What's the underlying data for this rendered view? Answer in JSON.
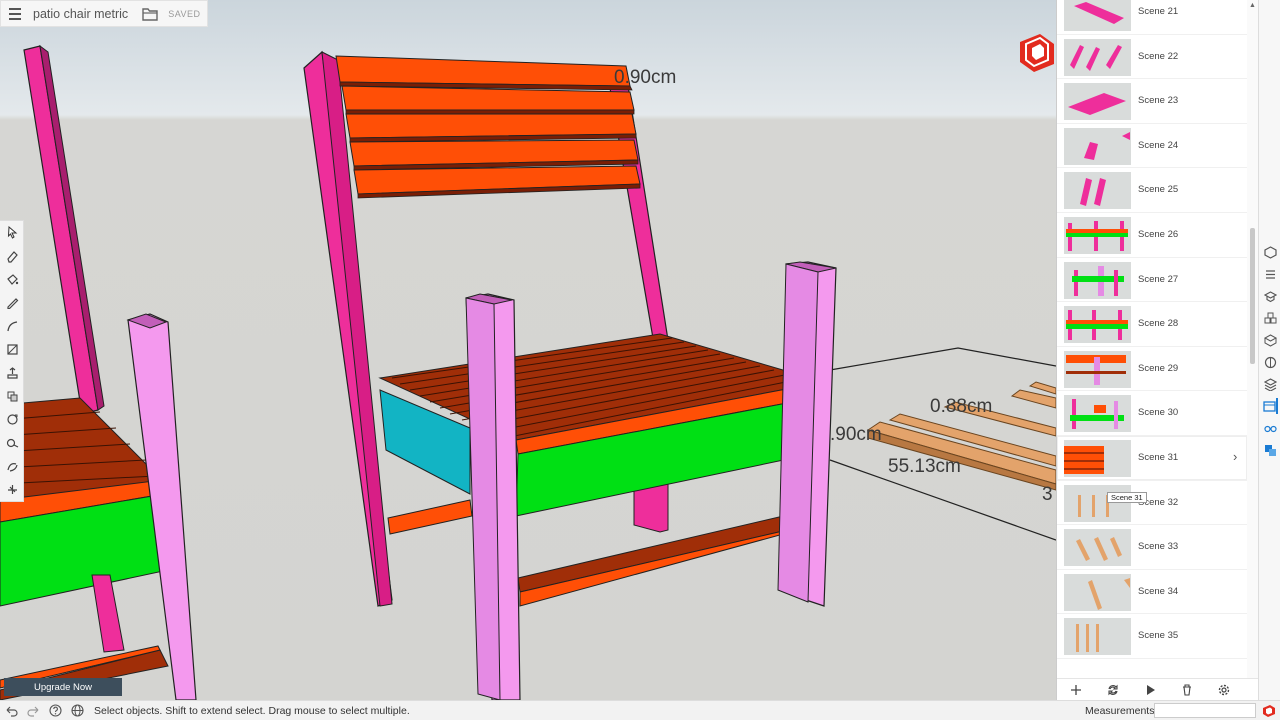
{
  "app": {
    "document_title": "patio chair metric",
    "save_state": "SAVED"
  },
  "viewport": {
    "dimensions": [
      "0.90cm",
      "0.88cm",
      ".90cm",
      "55.13cm",
      "3"
    ]
  },
  "toolbar": {
    "tools": [
      "select-tool",
      "eraser-tool",
      "paint-bucket-tool",
      "line-tool",
      "arc-tool",
      "rectangle-tool",
      "push-pull-tool",
      "move-tool",
      "rotate-tool",
      "tape-measure-tool",
      "orbit-tool",
      "section-plane-tool"
    ]
  },
  "upgrade": {
    "label": "Upgrade Now"
  },
  "status": {
    "message": "Select objects. Shift to extend select. Drag mouse to select multiple.",
    "measurements_label": "Measurements",
    "measurements_value": ""
  },
  "scenes": {
    "items": [
      {
        "name": "Scene 21"
      },
      {
        "name": "Scene 22"
      },
      {
        "name": "Scene 23"
      },
      {
        "name": "Scene 24"
      },
      {
        "name": "Scene 25"
      },
      {
        "name": "Scene 26"
      },
      {
        "name": "Scene 27"
      },
      {
        "name": "Scene 28"
      },
      {
        "name": "Scene 29"
      },
      {
        "name": "Scene 30"
      },
      {
        "name": "Scene 31"
      },
      {
        "name": "Scene 32"
      },
      {
        "name": "Scene 33"
      },
      {
        "name": "Scene 34"
      },
      {
        "name": "Scene 35"
      }
    ],
    "active_index": 10,
    "tooltip": "Scene 31"
  },
  "colors": {
    "slat_orange": "#ff4f06",
    "slat_dark": "#a02e08",
    "frame_magenta": "#ee2e9b",
    "leg_pink": "#e58ae4",
    "apron_green": "#00e014",
    "apron_cyan": "#12b4c4",
    "board_tan": "#e3a36b",
    "accent_blue": "#1a7bd3"
  }
}
